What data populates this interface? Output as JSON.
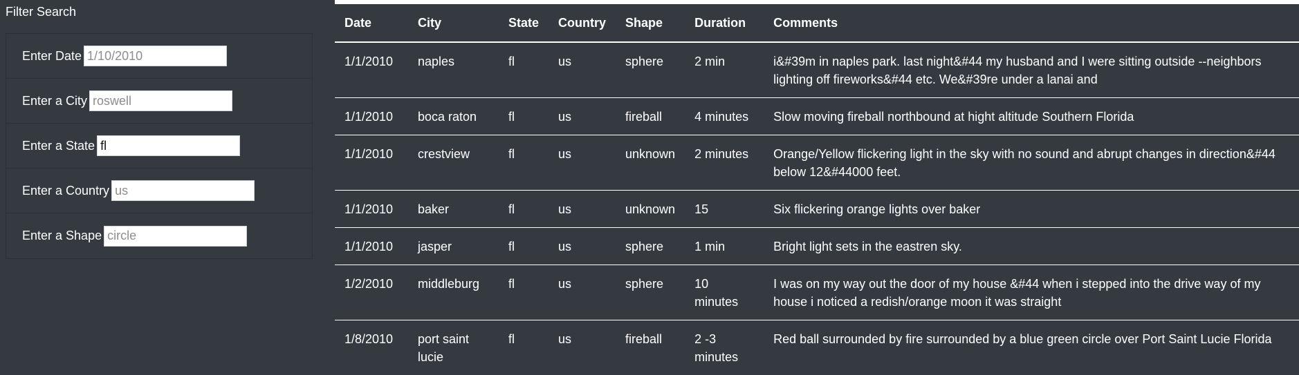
{
  "sidebar": {
    "title": "Filter Search",
    "filters": [
      {
        "label": "Enter Date",
        "value": "",
        "placeholder": "1/10/2010"
      },
      {
        "label": "Enter a City",
        "value": "",
        "placeholder": "roswell"
      },
      {
        "label": "Enter a State",
        "value": "fl",
        "placeholder": ""
      },
      {
        "label": "Enter a Country",
        "value": "",
        "placeholder": "us"
      },
      {
        "label": "Enter a Shape",
        "value": "",
        "placeholder": "circle"
      }
    ]
  },
  "table": {
    "headers": [
      "Date",
      "City",
      "State",
      "Country",
      "Shape",
      "Duration",
      "Comments"
    ],
    "rows": [
      {
        "date": "1/1/2010",
        "city": "naples",
        "state": "fl",
        "country": "us",
        "shape": "sphere",
        "duration": "2 min",
        "comments": "i&#39m in naples park. last night&#44 my husband and I were sitting outside --neighbors lighting off fireworks&#44 etc. We&#39re under a lanai and"
      },
      {
        "date": "1/1/2010",
        "city": "boca raton",
        "state": "fl",
        "country": "us",
        "shape": "fireball",
        "duration": "4 minutes",
        "comments": "Slow moving fireball northbound at hight altitude Southern Florida"
      },
      {
        "date": "1/1/2010",
        "city": "crestview",
        "state": "fl",
        "country": "us",
        "shape": "unknown",
        "duration": "2 minutes",
        "comments": "Orange/Yellow flickering light in the sky with no sound and abrupt changes in direction&#44 below 12&#44000 feet."
      },
      {
        "date": "1/1/2010",
        "city": "baker",
        "state": "fl",
        "country": "us",
        "shape": "unknown",
        "duration": "15",
        "comments": "Six flickering orange lights over baker"
      },
      {
        "date": "1/1/2010",
        "city": "jasper",
        "state": "fl",
        "country": "us",
        "shape": "sphere",
        "duration": "1 min",
        "comments": "Bright light sets in the eastren sky."
      },
      {
        "date": "1/2/2010",
        "city": "middleburg",
        "state": "fl",
        "country": "us",
        "shape": "sphere",
        "duration": "10 minutes",
        "comments": "I was on my way out the door of my house &#44 when i stepped into the drive way of my house i noticed a redish/orange moon it was straight"
      },
      {
        "date": "1/8/2010",
        "city": "port saint lucie",
        "state": "fl",
        "country": "us",
        "shape": "fireball",
        "duration": "2 -3 minutes",
        "comments": "Red ball surrounded by fire surrounded by a blue green circle over Port Saint Lucie Florida"
      }
    ]
  }
}
